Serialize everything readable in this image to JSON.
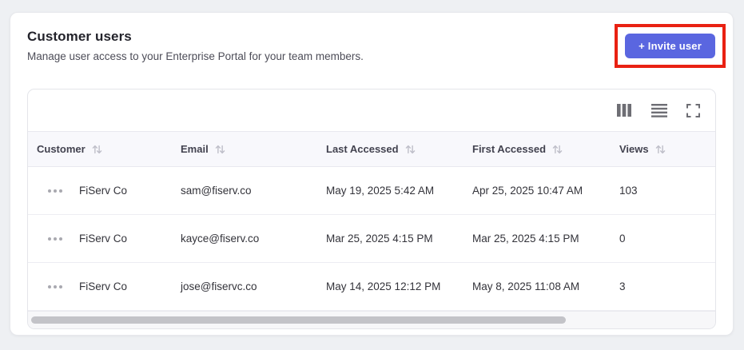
{
  "page": {
    "title": "Customer users",
    "subtitle": "Manage user access to your Enterprise Portal for your team members."
  },
  "invite_button": {
    "label": "+ Invite user",
    "color": "#5a66e0",
    "annotation_highlight_color": "#e92112"
  },
  "toolbar": {
    "icons": [
      "columns-icon",
      "row-density-icon",
      "fullscreen-icon"
    ]
  },
  "table": {
    "columns": [
      {
        "label": "Customer",
        "sortable": true
      },
      {
        "label": "Email",
        "sortable": true
      },
      {
        "label": "Last Accessed",
        "sortable": true
      },
      {
        "label": "First Accessed",
        "sortable": true
      },
      {
        "label": "Views",
        "sortable": true
      }
    ],
    "rows": [
      {
        "customer": "FiServ Co",
        "email": "sam@fiserv.co",
        "last_accessed": "May 19, 2025 5:42 AM",
        "first_accessed": "Apr 25, 2025 10:47 AM",
        "views": "103"
      },
      {
        "customer": "FiServ Co",
        "email": "kayce@fiserv.co",
        "last_accessed": "Mar 25, 2025 4:15 PM",
        "first_accessed": "Mar 25, 2025 4:15 PM",
        "views": "0"
      },
      {
        "customer": "FiServ Co",
        "email": "jose@fiservc.co",
        "last_accessed": "May 14, 2025 12:12 PM",
        "first_accessed": "May 8, 2025 11:08 AM",
        "views": "3"
      }
    ]
  }
}
